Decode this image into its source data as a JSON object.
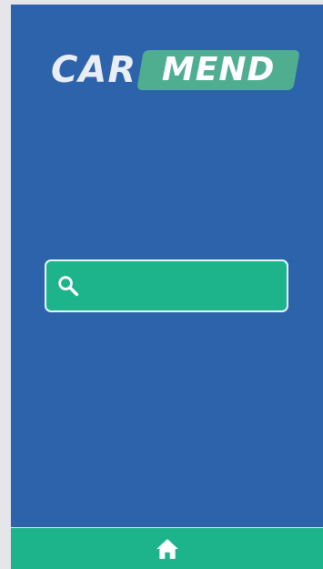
{
  "logo": {
    "part1": "CAR",
    "part2": "MEND"
  },
  "search": {
    "value": "",
    "placeholder": "",
    "icon": "search-icon"
  },
  "bottom_nav": {
    "home_icon": "home-icon"
  },
  "colors": {
    "background": "#2c63ab",
    "accent": "#1db38b",
    "logo_badge": "#4fae90",
    "outer": "#e6e6ea"
  }
}
